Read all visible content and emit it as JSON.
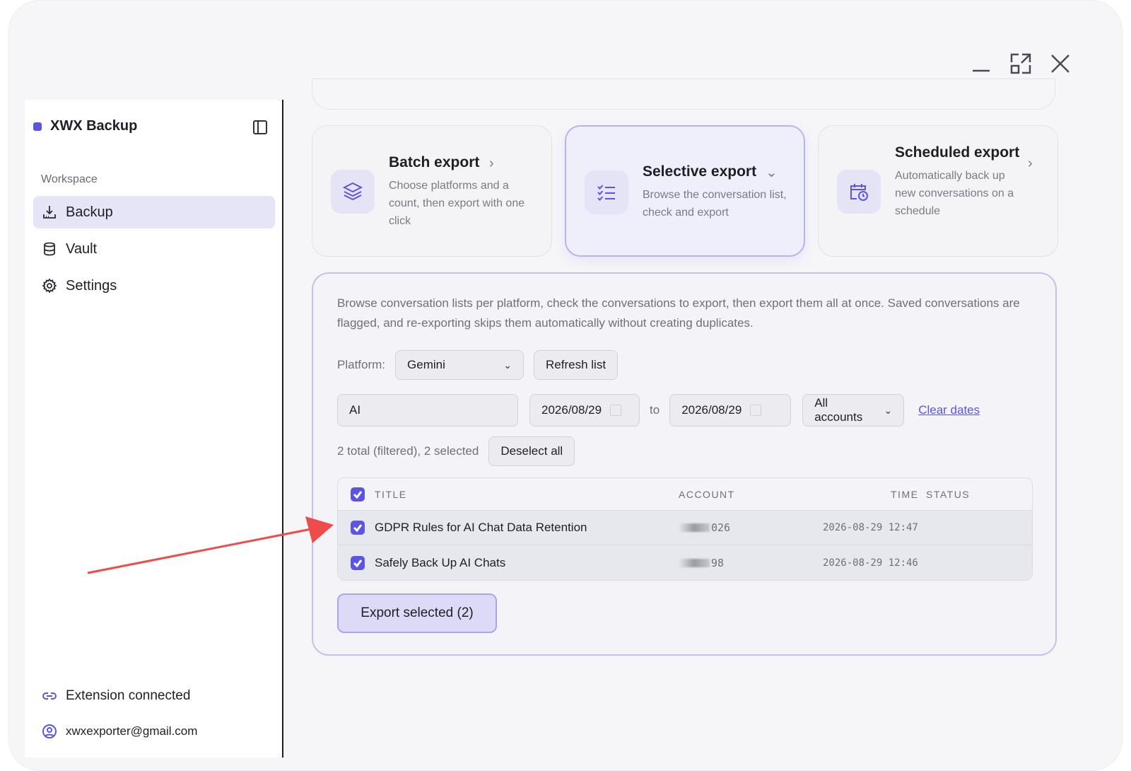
{
  "brand": {
    "name": "XWX Backup"
  },
  "sidebar": {
    "section_label": "Workspace",
    "items": [
      {
        "label": "Backup",
        "icon": "download-tray-icon",
        "active": true
      },
      {
        "label": "Vault",
        "icon": "database-icon",
        "active": false
      },
      {
        "label": "Settings",
        "icon": "gear-icon",
        "active": false
      }
    ],
    "footer": {
      "connection": "Extension connected",
      "account": "xwxexporter@gmail.com"
    }
  },
  "cards": [
    {
      "title": "Batch export",
      "desc": "Choose platforms and a count, then export with one click",
      "chevron": "›",
      "icon": "layers-icon",
      "active": false
    },
    {
      "title": "Selective export",
      "desc": "Browse the conversation list, check and export",
      "chevron": "⌄",
      "icon": "checklist-icon",
      "active": true
    },
    {
      "title": "Scheduled export",
      "desc": "Automatically back up new conversations on a schedule",
      "chevron": "›",
      "icon": "calendar-clock-icon",
      "active": false
    }
  ],
  "panel": {
    "description": "Browse conversation lists per platform, check the conversations to export, then export them all at once. Saved conversations are flagged, and re-exporting skips them automatically without creating duplicates.",
    "platform_label": "Platform:",
    "platform_value": "Gemini",
    "refresh_label": "Refresh list",
    "search_value": "AI",
    "date_from": "2026/08/29",
    "to_label": "to",
    "date_to": "2026/08/29",
    "accounts_value": "All accounts",
    "clear_dates_label": "Clear dates",
    "count_text": "2 total (filtered), 2 selected",
    "deselect_label": "Deselect all",
    "table": {
      "headers": {
        "title": "TITLE",
        "account": "ACCOUNT",
        "time": "TIME",
        "status": "STATUS"
      },
      "rows": [
        {
          "title": "GDPR Rules for AI Chat Data Retention",
          "account_suffix": "026",
          "time": "2026-08-29 12:47",
          "status": ""
        },
        {
          "title": "Safely Back Up AI Chats",
          "account_suffix": "98",
          "time": "2026-08-29 12:46",
          "status": ""
        }
      ]
    },
    "export_label": "Export selected (2)"
  },
  "colors": {
    "accent": "#5b55e0",
    "annotation_arrow": "#ee4b4b"
  }
}
